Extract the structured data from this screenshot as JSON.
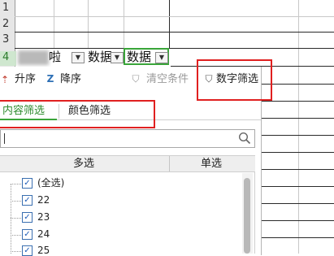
{
  "sheet": {
    "row_numbers": [
      "1",
      "2",
      "3",
      "4"
    ],
    "header_cells": [
      "啦",
      "数据",
      "数据"
    ]
  },
  "filter": {
    "sort_asc": "升序",
    "sort_desc": "降序",
    "clear_filter": "清空条件",
    "number_filter": "数字筛选",
    "tab_content": "内容筛选",
    "tab_color": "颜色筛选",
    "search_placeholder": "",
    "col_multi": "多选",
    "col_single": "单选",
    "items": [
      "(全选)",
      "22",
      "23",
      "24",
      "25"
    ],
    "check_mark": "✓"
  },
  "icons": {
    "sort_asc": "sort-ascending-icon",
    "sort_desc": "sort-descending-icon",
    "clear": "clear-filter-icon",
    "number_filter": "number-filter-icon",
    "search": "search-icon",
    "dropdown": "dropdown-arrow-icon"
  },
  "colors": {
    "highlight_red": "#e02020",
    "active_tab_green": "#3aa53a",
    "checkbox_blue": "#1e5db8"
  }
}
